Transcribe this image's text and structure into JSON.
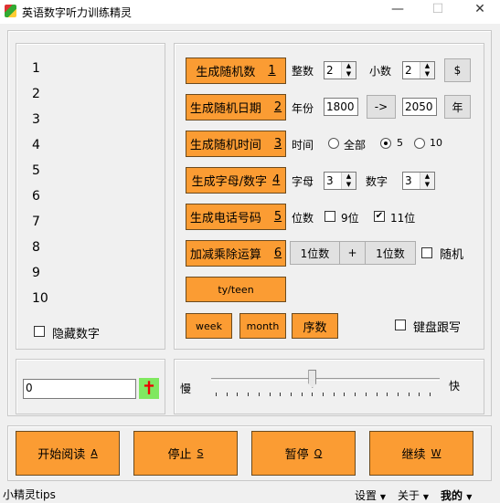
{
  "window": {
    "title": "英语数字听力训练精灵",
    "minimize": "—",
    "maximize": "☐",
    "close": "✕"
  },
  "numbers": [
    "1",
    "2",
    "3",
    "4",
    "5",
    "6",
    "7",
    "8",
    "9",
    "10"
  ],
  "hide_numbers": {
    "label": "隐藏数字",
    "checked": false
  },
  "rows": {
    "random_number": {
      "label": "生成随机数",
      "key": "1",
      "int_label": "整数",
      "int_value": "2",
      "dec_label": "小数",
      "dec_value": "2",
      "currency": "$"
    },
    "random_date": {
      "label": "生成随机日期",
      "key": "2",
      "year_label": "年份",
      "from": "1800",
      "arrow": "->",
      "to": "2050",
      "year_btn": "年"
    },
    "random_time": {
      "label": "生成随机时间",
      "key": "3",
      "time_label": "时间",
      "options": [
        "全部",
        "5",
        "10"
      ],
      "selected": "5"
    },
    "letters_digits": {
      "label": "生成字母/数字",
      "key": "4",
      "letters_label": "字母",
      "letters_value": "3",
      "digits_label": "数字",
      "digits_value": "3"
    },
    "phone": {
      "label": "生成电话号码",
      "key": "5",
      "digits_label": "位数",
      "opt9": "9位",
      "opt9_checked": false,
      "opt11": "11位",
      "opt11_checked": true
    },
    "arith": {
      "label": "加减乘除运算",
      "key": "6",
      "left": "1位数",
      "op": "+",
      "right": "1位数",
      "random_label": "随机",
      "random_checked": false
    },
    "ty_teen": "ty/teen",
    "week": "week",
    "month": "month",
    "ordinal": "序数",
    "keyboard_follow": {
      "label": "键盘跟写",
      "checked": false
    }
  },
  "counter": {
    "value": "0",
    "icon": "red-cross-icon"
  },
  "speed": {
    "slow": "慢",
    "fast": "快",
    "value": 9,
    "min": 0,
    "max": 20
  },
  "actions": [
    {
      "label": "开始阅读",
      "key": "A"
    },
    {
      "label": "停止",
      "key": "S"
    },
    {
      "label": "暂停",
      "key": "Q"
    },
    {
      "label": "继续",
      "key": "W"
    }
  ],
  "status": {
    "tips": "小精灵tips",
    "menus": [
      "设置",
      "关于",
      "我的"
    ]
  },
  "colors": {
    "accent": "#fb9c33"
  }
}
